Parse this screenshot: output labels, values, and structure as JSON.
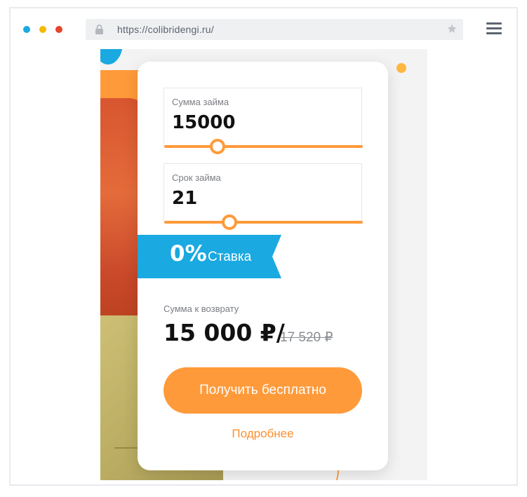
{
  "browser": {
    "url": "https://colibridengi.ru/",
    "icons": {
      "lock": "lock-icon",
      "star": "star-icon",
      "menu": "hamburger-menu-icon"
    }
  },
  "calculator": {
    "loan_amount": {
      "label": "Сумма займа",
      "value": "15000",
      "slider_fraction": 0.27
    },
    "loan_term": {
      "label": "Срок займа",
      "value": "21",
      "slider_fraction": 0.33
    },
    "rate": {
      "percent": "0%",
      "label": "Ставка"
    },
    "return": {
      "label": "Сумма к возврату",
      "amount": "15 000 ₽/",
      "old_amount": "17 520 ₽"
    },
    "cta_label": "Получить бесплатно",
    "more_link": "Подробнее"
  },
  "colors": {
    "accent_orange": "#ff9a3a",
    "ribbon_blue": "#1aa9e0",
    "dot_blue": "#1aa9e0",
    "dot_yellow": "#f5b800",
    "dot_red": "#e5452a"
  }
}
